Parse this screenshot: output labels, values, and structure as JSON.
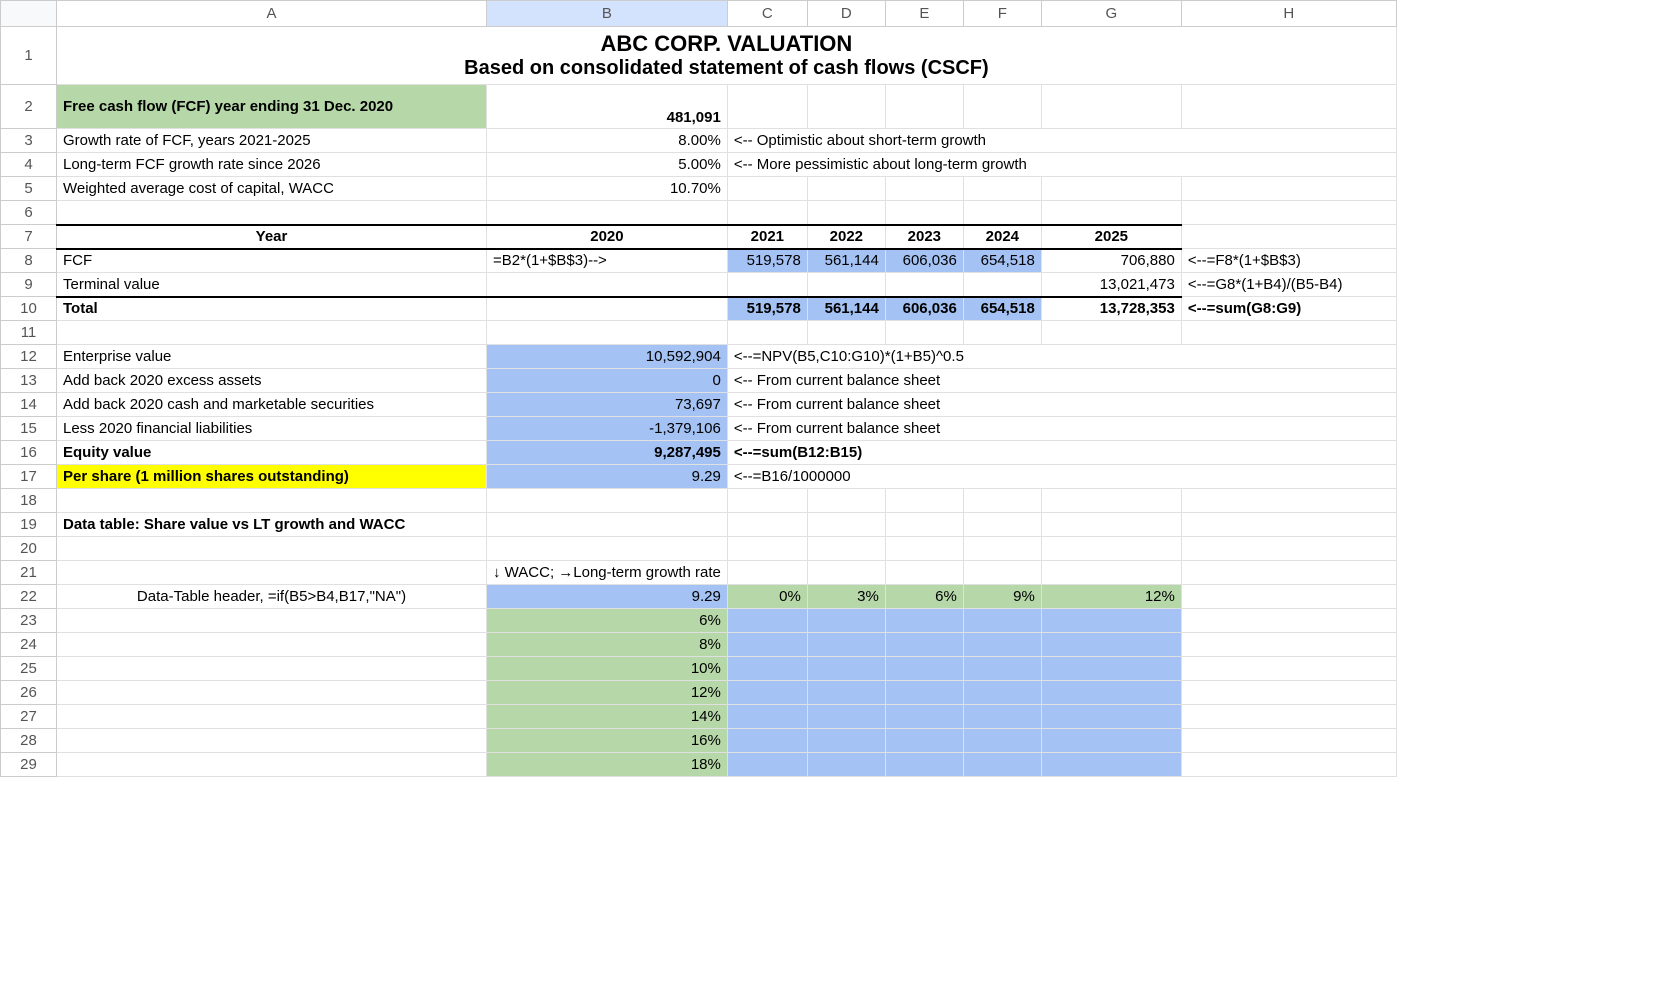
{
  "columns": [
    "A",
    "B",
    "C",
    "D",
    "E",
    "F",
    "G",
    "H"
  ],
  "rows": [
    "1",
    "2",
    "3",
    "4",
    "5",
    "6",
    "7",
    "8",
    "9",
    "10",
    "11",
    "12",
    "13",
    "14",
    "15",
    "16",
    "17",
    "18",
    "19",
    "20",
    "21",
    "22",
    "23",
    "24",
    "25",
    "26",
    "27",
    "28",
    "29"
  ],
  "selected_col": "B",
  "title_line1": "ABC CORP. VALUATION",
  "title_line2": "Based on consolidated statement of cash flows (CSCF)",
  "r2": {
    "a": "Free cash flow (FCF) year ending 31 Dec. 2020",
    "b": "481,091"
  },
  "r3": {
    "a": "Growth rate of FCF, years 2021-2025",
    "b": "8.00%",
    "c": "<-- Optimistic about short-term growth"
  },
  "r4": {
    "a": "Long-term FCF growth rate since 2026",
    "b": "5.00%",
    "c": "<-- More pessimistic about long-term growth"
  },
  "r5": {
    "a": "Weighted average cost of capital, WACC",
    "b": "10.70%"
  },
  "r7": {
    "a": "Year",
    "b": "2020",
    "c": "2021",
    "d": "2022",
    "e": "2023",
    "f": "2024",
    "g": "2025"
  },
  "r8": {
    "a": "FCF",
    "b": "=B2*(1+$B$3)-->",
    "c": "519,578",
    "d": "561,144",
    "e": "606,036",
    "f": "654,518",
    "g": "706,880",
    "h": "<--=F8*(1+$B$3)"
  },
  "r9": {
    "a": "Terminal value",
    "g": "13,021,473",
    "h": "<--=G8*(1+B4)/(B5-B4)"
  },
  "r10": {
    "a": "Total",
    "c": "519,578",
    "d": "561,144",
    "e": "606,036",
    "f": "654,518",
    "g": "13,728,353",
    "h": "<--=sum(G8:G9)"
  },
  "r12": {
    "a": "Enterprise value",
    "b": "10,592,904",
    "c": "<--=NPV(B5,C10:G10)*(1+B5)^0.5"
  },
  "r13": {
    "a": "Add back 2020 excess assets",
    "b": "0",
    "c": "<-- From current balance sheet"
  },
  "r14": {
    "a": "Add back 2020 cash and marketable securities",
    "b": "73,697",
    "c": "<-- From current balance sheet"
  },
  "r15": {
    "a": "Less 2020 financial liabilities",
    "b": "-1,379,106",
    "c": "<-- From current balance sheet"
  },
  "r16": {
    "a": "Equity value",
    "b": "9,287,495",
    "c": "<--=sum(B12:B15)"
  },
  "r17": {
    "a": "Per share (1 million shares outstanding)",
    "b": "9.29",
    "c": "<--=B16/1000000"
  },
  "r19": {
    "a": "Data table:  Share value vs LT growth and WACC"
  },
  "r21": {
    "b": "↓ WACC; →Long-term growth rate"
  },
  "r22": {
    "a": "Data-Table header, =if(B5>B4,B17,\"NA\")",
    "b": "9.29",
    "c": "0%",
    "d": "3%",
    "e": "6%",
    "f": "9%",
    "g": "12%"
  },
  "r23": {
    "b": "6%"
  },
  "r24": {
    "b": "8%"
  },
  "r25": {
    "b": "10%"
  },
  "r26": {
    "b": "12%"
  },
  "r27": {
    "b": "14%"
  },
  "r28": {
    "b": "16%"
  },
  "r29": {
    "b": "18%"
  }
}
